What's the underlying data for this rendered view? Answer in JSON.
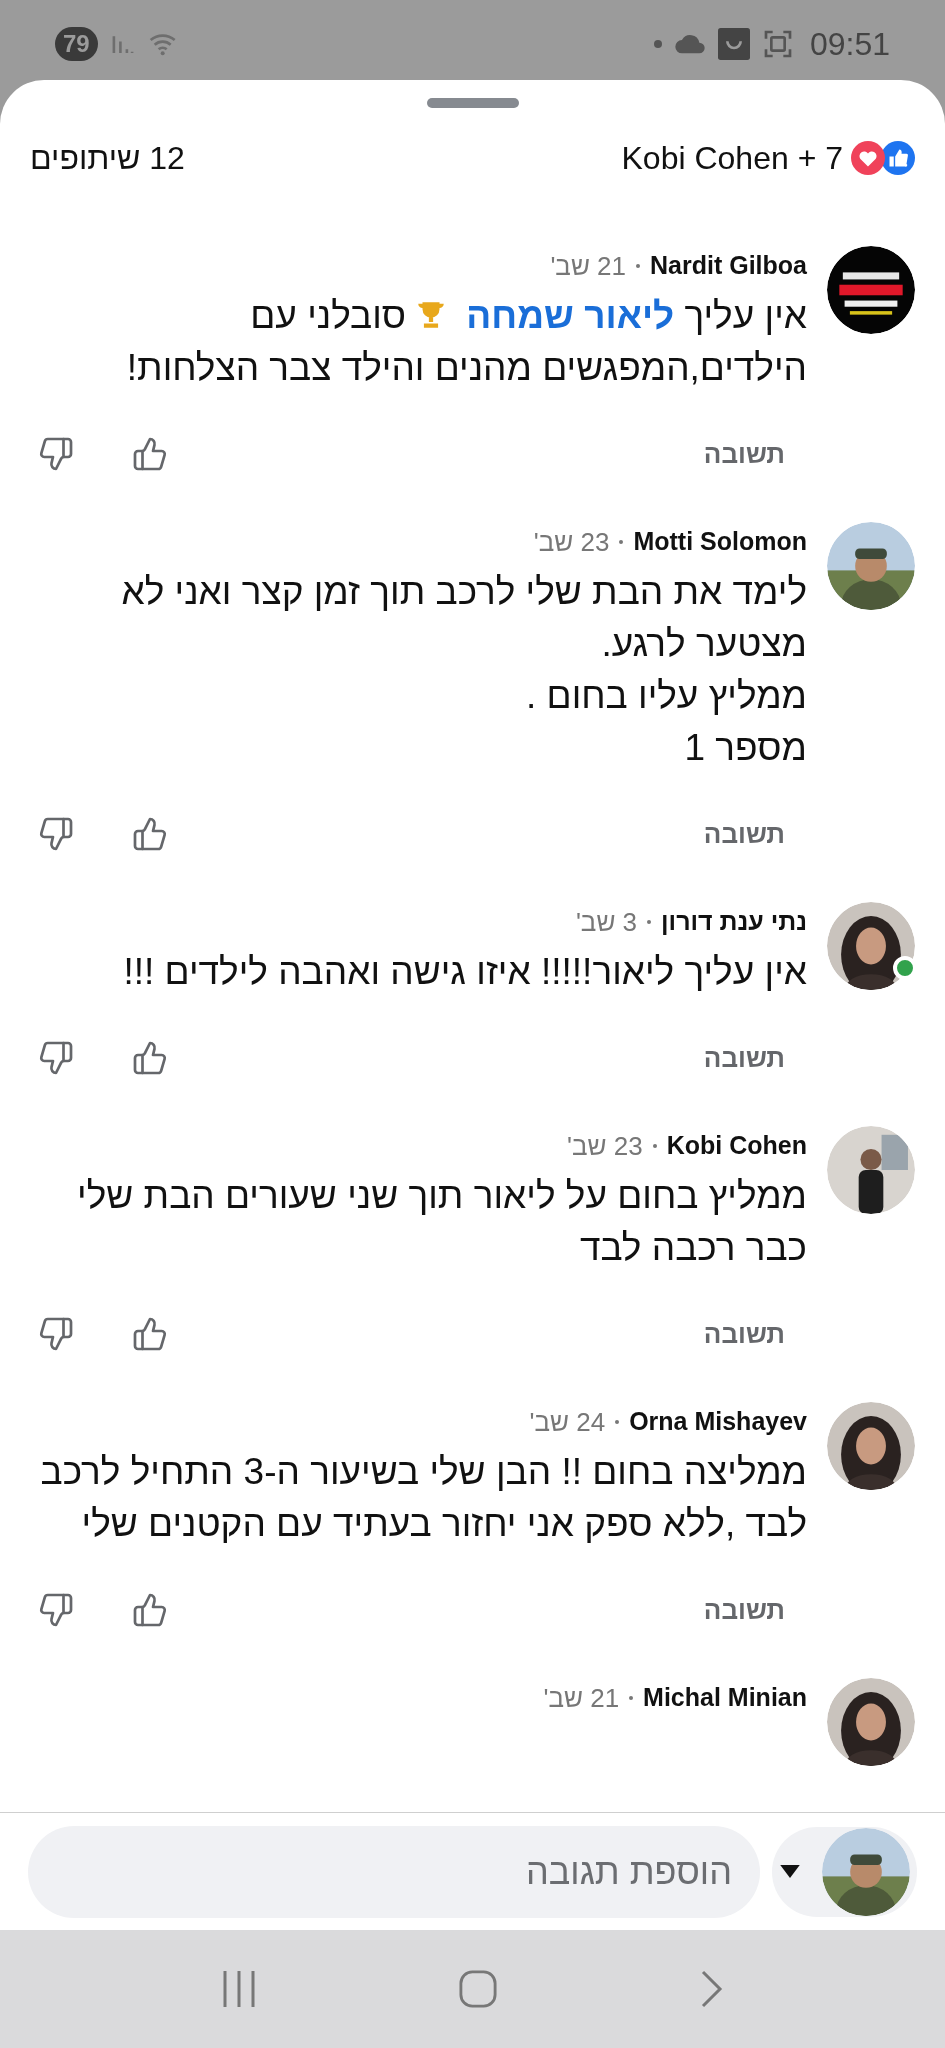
{
  "status_bar": {
    "battery": "79",
    "time": "09:51"
  },
  "header": {
    "reactions_summary": "Kobi Cohen + 7",
    "shares": "12 שיתופים"
  },
  "comments": [
    {
      "author": "Nardit Gilboa",
      "date": "21 שב'",
      "online": false,
      "body": [
        [
          {
            "kind": "text",
            "text": "אין עליך"
          },
          {
            "kind": "mention",
            "text": "ליאור שמחה"
          },
          {
            "kind": "trophy"
          },
          {
            "kind": "text",
            "text": "סובלני עם הילדים,המפגשים מהנים והילד צבר הצלחות!"
          }
        ]
      ],
      "reply": "תשובה"
    },
    {
      "author": "Motti Solomon",
      "date": "23 שב'",
      "online": false,
      "body": [
        [
          {
            "kind": "text",
            "text": "לימד את הבת שלי לרכב תוך זמן קצר ואני לא מצטער לרגע."
          }
        ],
        [
          {
            "kind": "text",
            "text": "ממליץ עליו בחום ."
          }
        ],
        [
          {
            "kind": "text",
            "text": "מספר 1"
          }
        ]
      ],
      "reply": "תשובה"
    },
    {
      "author": "נתי ענת דורון",
      "date": "3 שב'",
      "online": true,
      "body": [
        [
          {
            "kind": "text",
            "text": "אין עליך ליאור!!!!! איזו גישה ואהבה לילדים !!!"
          }
        ]
      ],
      "reply": "תשובה"
    },
    {
      "author": "Kobi Cohen",
      "date": "23 שב'",
      "online": false,
      "body": [
        [
          {
            "kind": "text",
            "text": "ממליץ בחום על ליאור תוך שני שעורים הבת שלי כבר רכבה לבד"
          }
        ]
      ],
      "reply": "תשובה"
    },
    {
      "author": "Orna Mishayev",
      "date": "24 שב'",
      "online": false,
      "body": [
        [
          {
            "kind": "text",
            "text": "ממליצה בחום !! הבן שלי בשיעור ה-3 התחיל לרכב לבד ,ללא ספק אני יחזור בעתיד עם הקטנים שלי"
          }
        ]
      ],
      "reply": "תשובה"
    },
    {
      "author": "Michal Minian",
      "date": "21 שב'",
      "online": false
    }
  ],
  "composer": {
    "placeholder": "הוספת תגובה"
  }
}
